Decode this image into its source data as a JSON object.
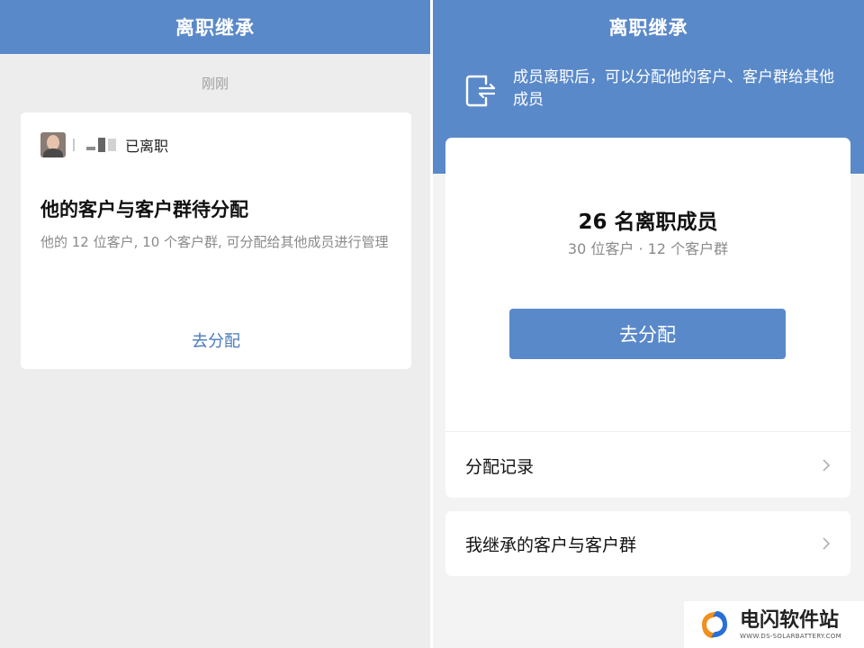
{
  "left": {
    "title": "离职继承",
    "timestamp": "刚刚",
    "message": {
      "status": "已离职",
      "title": "他的客户与客户群待分配",
      "body": "他的 12 位客户, 10 个客户群, 可分配给其他成员进行管理",
      "action": "去分配"
    }
  },
  "right": {
    "title": "离职继承",
    "intro": "成员离职后，可以分配他的客户、客户群给其他成员",
    "summary": {
      "title": "26 名离职成员",
      "subtitle": "30 位客户 · 12 个客户群",
      "button": "去分配"
    },
    "rows": [
      {
        "label": "分配记录"
      },
      {
        "label": "我继承的客户与客户群"
      }
    ]
  },
  "watermark": {
    "name": "电闪软件站",
    "url": "WWW.DS-SOLARBATTERY.COM"
  },
  "colors": {
    "brand": "#5a89c9",
    "link": "#4a7ab8"
  },
  "icons": {
    "exit": "exit-icon",
    "chevron": "chevron-right-icon"
  }
}
